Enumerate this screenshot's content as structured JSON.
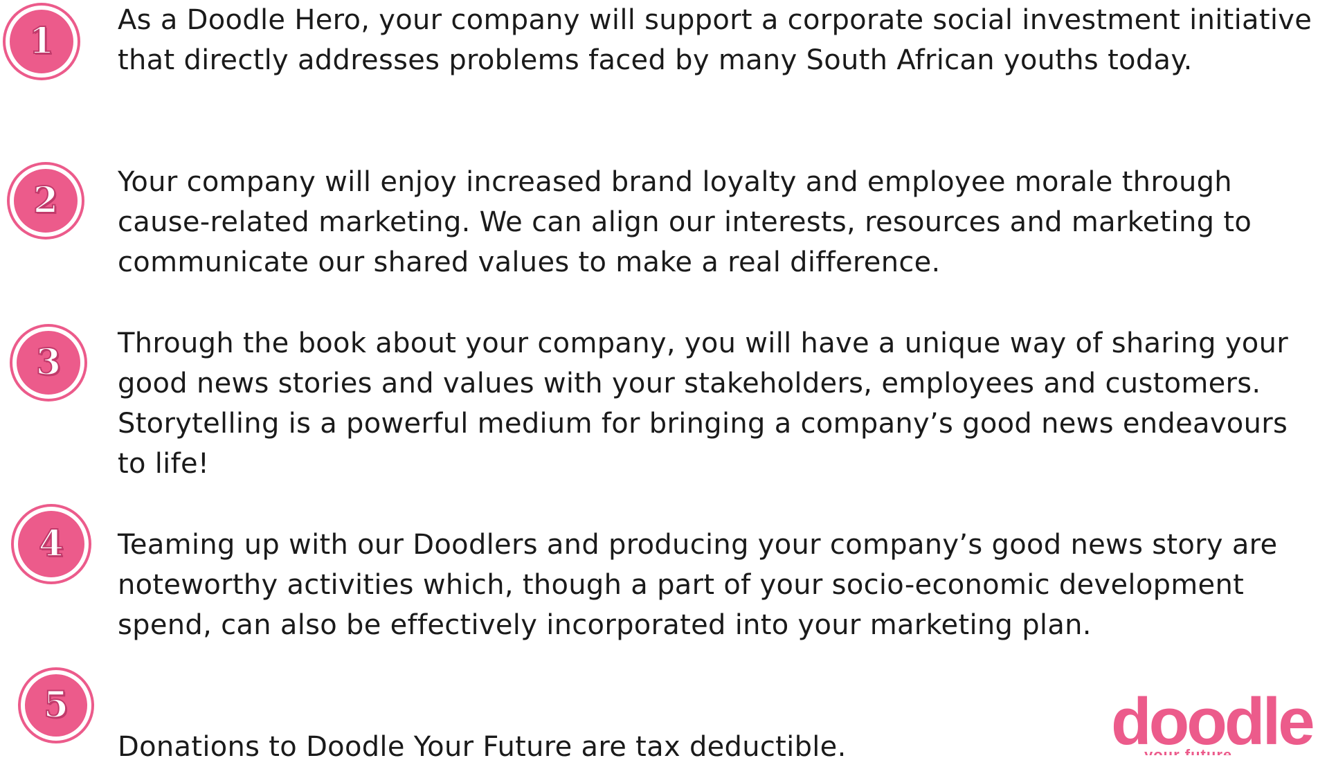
{
  "items": [
    {
      "number": "1",
      "text": "As a Doodle Hero, your company will support a corporate social investment initiative that directly addresses problems faced by many South African youths today."
    },
    {
      "number": "2",
      "text": "Your company will enjoy increased brand loyalty and employee morale through cause-related marketing. We can align our interests, resources and marketing to communicate our shared values to make a real difference."
    },
    {
      "number": "3",
      "text": "Through the book about your company, you will have a unique way of sharing your good news stories and values with your stakeholders, employees and customers. Storytelling is a powerful medium for bringing a company’s good news endeavours to life!"
    },
    {
      "number": "4",
      "text": "Teaming up with our Doodlers and producing your company’s good news story are noteworthy activities which, though a part of your socio-economic development spend, can also be effectively incorporated into your marketing plan."
    },
    {
      "number": "5",
      "text": "Donations to Doodle Your Future are tax deductible."
    }
  ],
  "logo": {
    "word": "doodle",
    "tagline": "your future"
  },
  "colors": {
    "accent": "#ec5b8b",
    "text": "#1a1a1a",
    "background": "#ffffff"
  }
}
